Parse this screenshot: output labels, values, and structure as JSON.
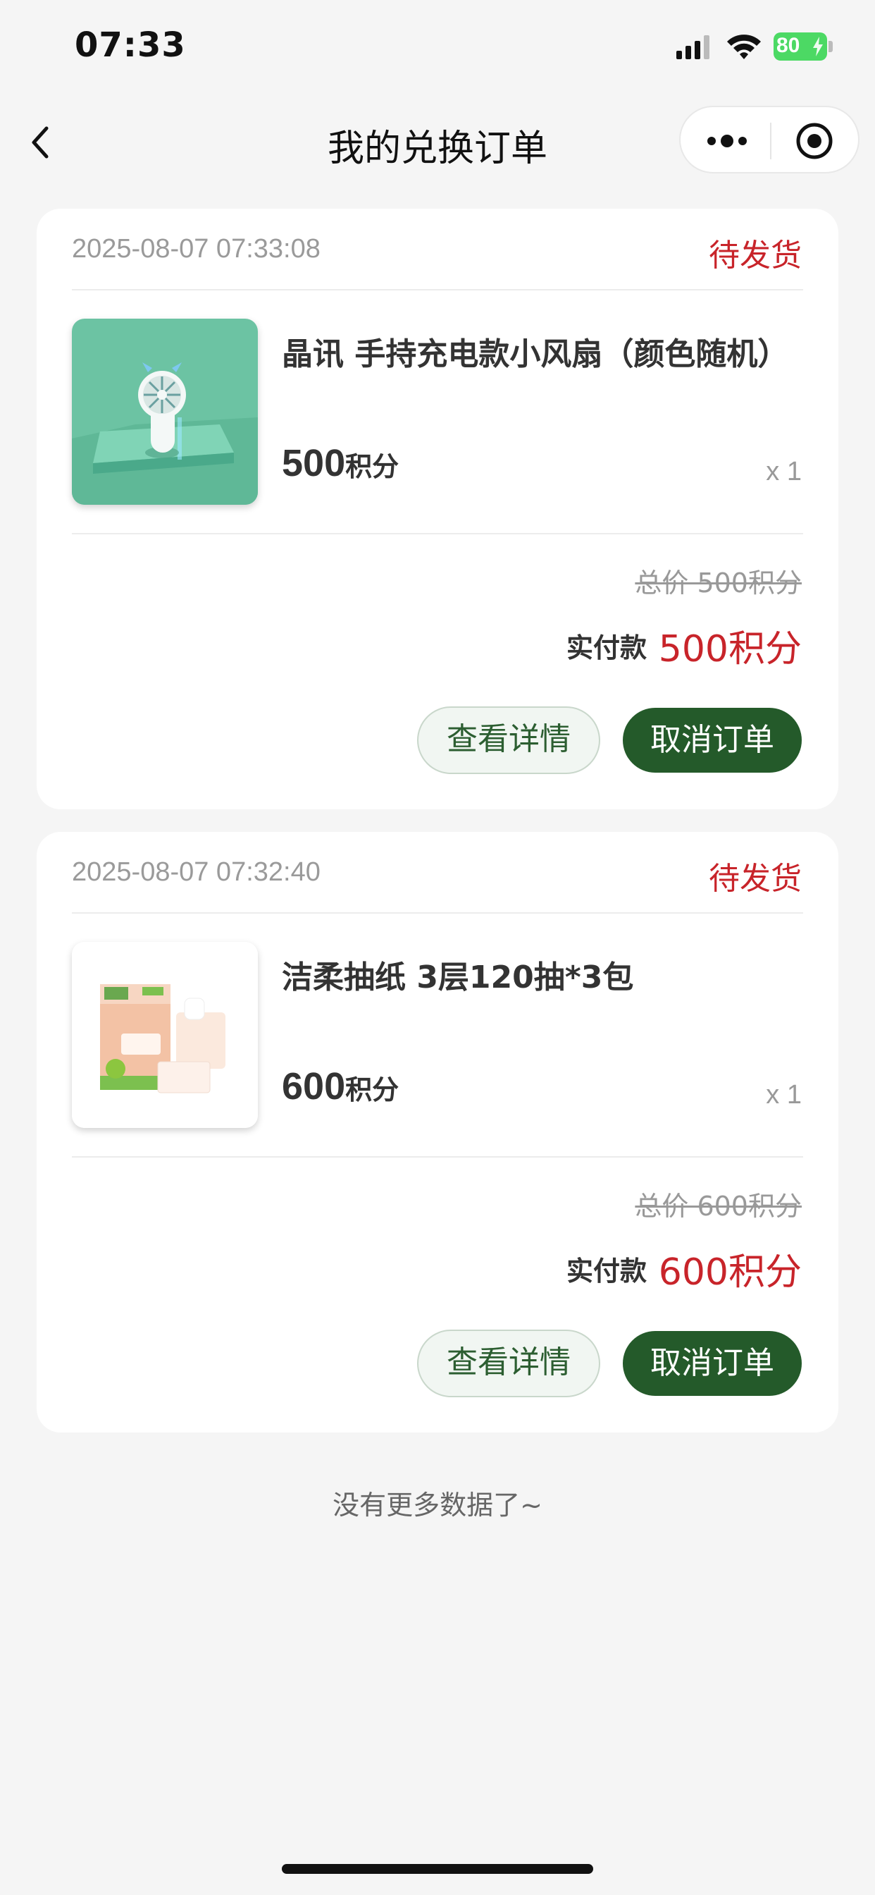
{
  "status_bar": {
    "time": "07:33",
    "battery": "80"
  },
  "nav": {
    "title": "我的兑换订单"
  },
  "orders": [
    {
      "time": "2025-08-07 07:33:08",
      "status": "待发货",
      "product_name": "晶讯 手持充电款小风扇（颜色随机）",
      "price": "500",
      "price_unit": "积分",
      "qty": "x 1",
      "total": "总价  500积分",
      "paid_label": "实付款",
      "paid_value": "500积分",
      "detail_label": "查看详情",
      "cancel_label": "取消订单",
      "image": "mini-fan-icon"
    },
    {
      "time": "2025-08-07 07:32:40",
      "status": "待发货",
      "product_name": "洁柔抽纸 3层120抽*3包",
      "price": "600",
      "price_unit": "积分",
      "qty": "x 1",
      "total": "总价  600积分",
      "paid_label": "实付款",
      "paid_value": "600积分",
      "detail_label": "查看详情",
      "cancel_label": "取消订单",
      "image": "tissue-pack-icon"
    }
  ],
  "footer": {
    "no_more": "没有更多数据了~"
  },
  "colors": {
    "accent_red": "#c8242a",
    "primary_green": "#245a2a",
    "background": "#f5f5f5"
  }
}
